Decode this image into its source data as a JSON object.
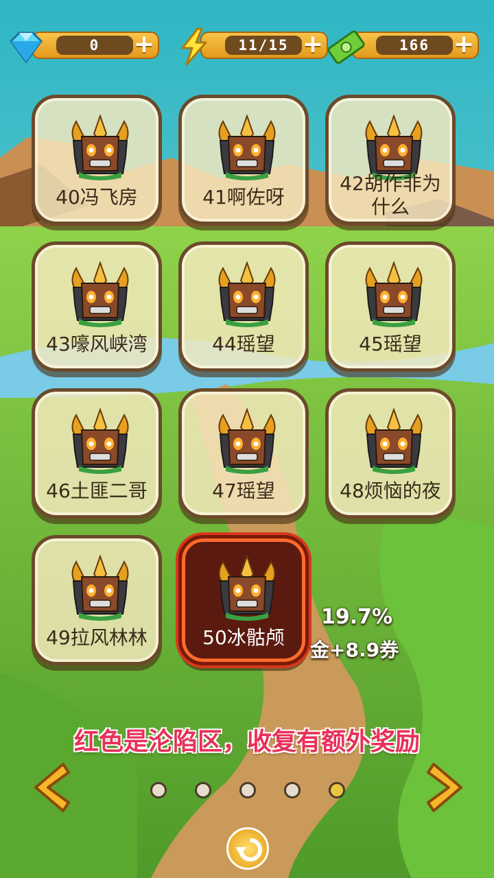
{
  "resources": {
    "gems": "0",
    "energy": "11/15",
    "cash": "166"
  },
  "levels": [
    {
      "name": "40冯飞房"
    },
    {
      "name": "41啊佐呀"
    },
    {
      "name": "42胡作非为什么"
    },
    {
      "name": "43嚎风峡湾"
    },
    {
      "name": "44瑶望"
    },
    {
      "name": "45瑶望"
    },
    {
      "name": "46土匪二哥"
    },
    {
      "name": "47瑶望"
    },
    {
      "name": "48烦恼的夜"
    },
    {
      "name": "49拉风林林"
    },
    {
      "name": "50冰骷颅",
      "status": "occupied"
    }
  ],
  "selected_level": {
    "completion": "19.7%",
    "reward": "金+8.9券"
  },
  "tip": "红色是沦陷区，收复有额外奖励",
  "pagination": {
    "pages": 5,
    "current": 5
  },
  "colors": {
    "tip": "#e8305a",
    "occupied_border": "#d8381a"
  }
}
